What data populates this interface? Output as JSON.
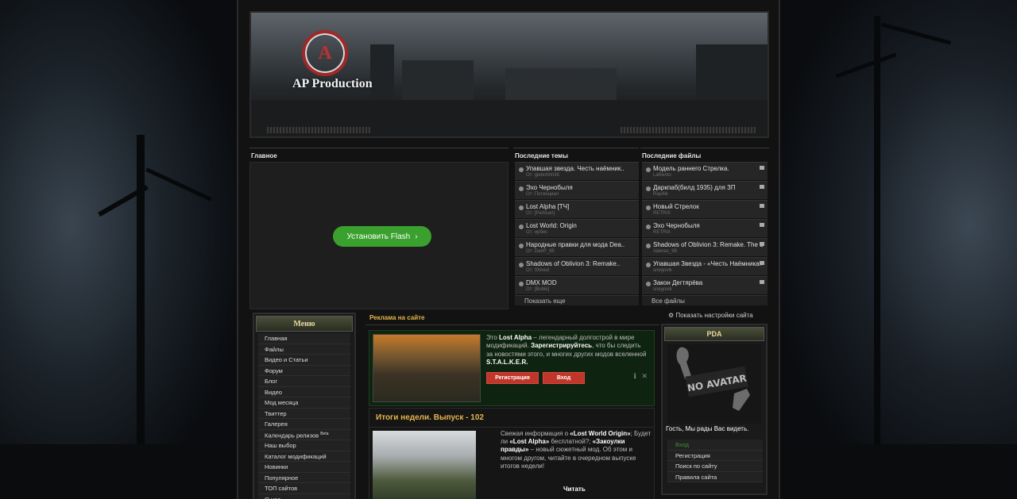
{
  "brand": {
    "logo_letter": "A",
    "name": "AP Production"
  },
  "columns": {
    "main": "Главное",
    "topics": "Последние темы",
    "files": "Последние файлы"
  },
  "flash_button": "Установить Flash",
  "topics": [
    {
      "title": "Упавшая звезда. Честь наёмник..",
      "sub": "От: glebchhh36"
    },
    {
      "title": "Эхо Чернобыля",
      "sub": "От: Потенциал"
    },
    {
      "title": "Lost Alpha [ТЧ]",
      "sub": "От: [Partisan]"
    },
    {
      "title": "Lost World: Origin",
      "sub": "От: ирбис"
    },
    {
      "title": "Народные правки для мода Dea..",
      "sub": "От: DeeP_85"
    },
    {
      "title": "Shadows of Oblivion 3: Remake..",
      "sub": "От: Shived"
    },
    {
      "title": "DMX MOD",
      "sub": "От: [Bobik]"
    }
  ],
  "topics_more": "Показать еще",
  "files": [
    {
      "title": "Модель раннего Стрелка.",
      "sub": "LaRento"
    },
    {
      "title": "Даркпаб(билд 1935) для ЗП",
      "sub": "Rap4ik"
    },
    {
      "title": "Новый Стрелок",
      "sub": "RETRIX"
    },
    {
      "title": "Эхо Чернобыля",
      "sub": "RETRIX"
    },
    {
      "title": "Shadows of Oblivion 3: Remake. The d",
      "sub": "Valeras_98"
    },
    {
      "title": "Упавшая Звезда - «Честь Наёмника»",
      "sub": "snegovik"
    },
    {
      "title": "Закон Дегтярёва",
      "sub": "snegovik"
    }
  ],
  "files_more": "Все файлы",
  "menu": {
    "title": "Меню",
    "items": [
      "Главная",
      "Файлы",
      "Видео и Статьи",
      "Форум",
      "Блог",
      "Видео",
      "Мод месяца",
      "Твиттер",
      "Галерея",
      "Календарь релизов",
      "Наш выбор",
      "Каталог модификаций",
      "Новинки",
      "Популярное",
      "ТОП сайтов",
      "О нас"
    ],
    "beta": "Beta"
  },
  "ad": {
    "label": "Реклама на сайте",
    "text_pre": "Это ",
    "text_bold1": "Lost Alpha",
    "text_mid": " – легендарный долгострой в мире модификаций. ",
    "text_bold2": "Зарегистрируйтесь",
    "text_post": ", что бы следить за новостями этого, и многих других модов вселенной ",
    "text_bold3": "S.T.A.L.K.E.R.",
    "register": "Регистрация",
    "login": "Вход"
  },
  "news": {
    "title": "Итоги недели. Выпуск - 102",
    "p1": "Свежая информация о ",
    "b1": "«Lost World Origin»",
    "p2": "; Будет ли ",
    "b2": "«Lost Alpha»",
    "p3": " бесплатной?; ",
    "b3": "«Закоулки правды»",
    "p4": " – новый сюжетный мод. Об этом и многом другом, читайте в очередном выпуске итогов недели!",
    "read": "Читать"
  },
  "settings_link": "Показать настройки сайта",
  "pda": {
    "title": "PDA",
    "avatar_text": "NO AVATAR",
    "welcome": "Гость, Мы рады Вас видеть.",
    "links": [
      "Вход",
      "Регистрация",
      "Поиск по сайту",
      "Правила сайта"
    ]
  }
}
